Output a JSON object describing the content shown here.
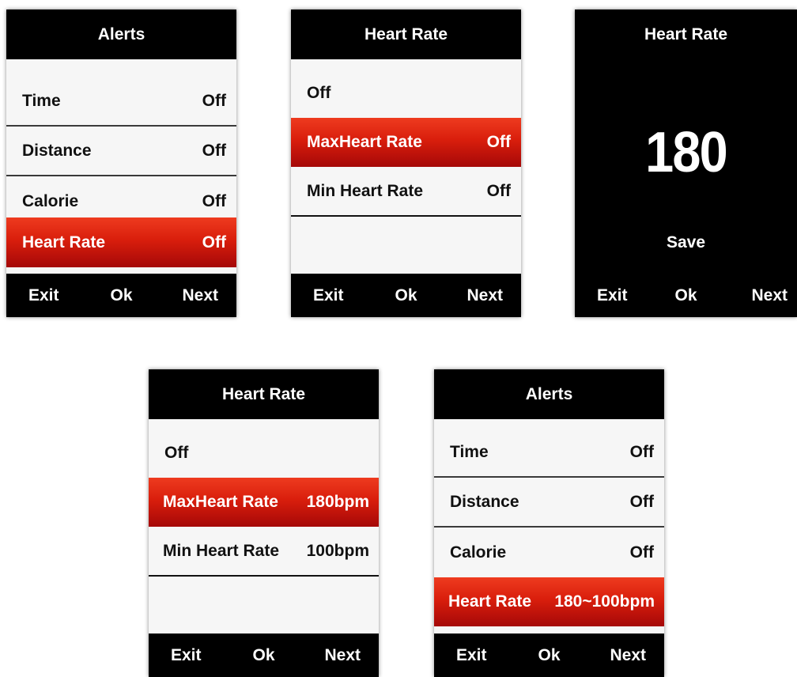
{
  "screens": [
    {
      "title": "Alerts",
      "rows": [
        {
          "label": "Time",
          "value": "Off"
        },
        {
          "label": "Distance",
          "value": "Off"
        },
        {
          "label": "Calorie",
          "value": "Off"
        },
        {
          "label": "Heart Rate",
          "value": "Off",
          "selected": true
        }
      ],
      "footer": {
        "exit": "Exit",
        "ok": "Ok",
        "next": "Next"
      }
    },
    {
      "title": "Heart Rate",
      "rows": [
        {
          "label": "Off",
          "value": ""
        },
        {
          "label": "MaxHeart Rate",
          "value": "Off",
          "selected": true
        },
        {
          "label": "Min Heart Rate",
          "value": "Off"
        }
      ],
      "footer": {
        "exit": "Exit",
        "ok": "Ok",
        "next": "Next"
      }
    },
    {
      "title": "Heart Rate",
      "value": "180",
      "save": "Save",
      "footer": {
        "exit": "Exit",
        "ok": "Ok",
        "next": "Next"
      }
    },
    {
      "title": "Heart Rate",
      "rows": [
        {
          "label": "Off",
          "value": ""
        },
        {
          "label": "MaxHeart Rate",
          "value": "180bpm",
          "selected": true
        },
        {
          "label": "Min Heart Rate",
          "value": "100bpm"
        }
      ],
      "footer": {
        "exit": "Exit",
        "ok": "Ok",
        "next": "Next"
      }
    },
    {
      "title": "Alerts",
      "rows": [
        {
          "label": "Time",
          "value": "Off"
        },
        {
          "label": "Distance",
          "value": "Off"
        },
        {
          "label": "Calorie",
          "value": "Off"
        },
        {
          "label": "Heart Rate",
          "value": "180~100bpm",
          "selected": true
        }
      ],
      "footer": {
        "exit": "Exit",
        "ok": "Ok",
        "next": "Next"
      }
    }
  ],
  "colors": {
    "highlight": "#d91e0c",
    "bar": "#000000",
    "list_bg": "#f6f6f6"
  }
}
